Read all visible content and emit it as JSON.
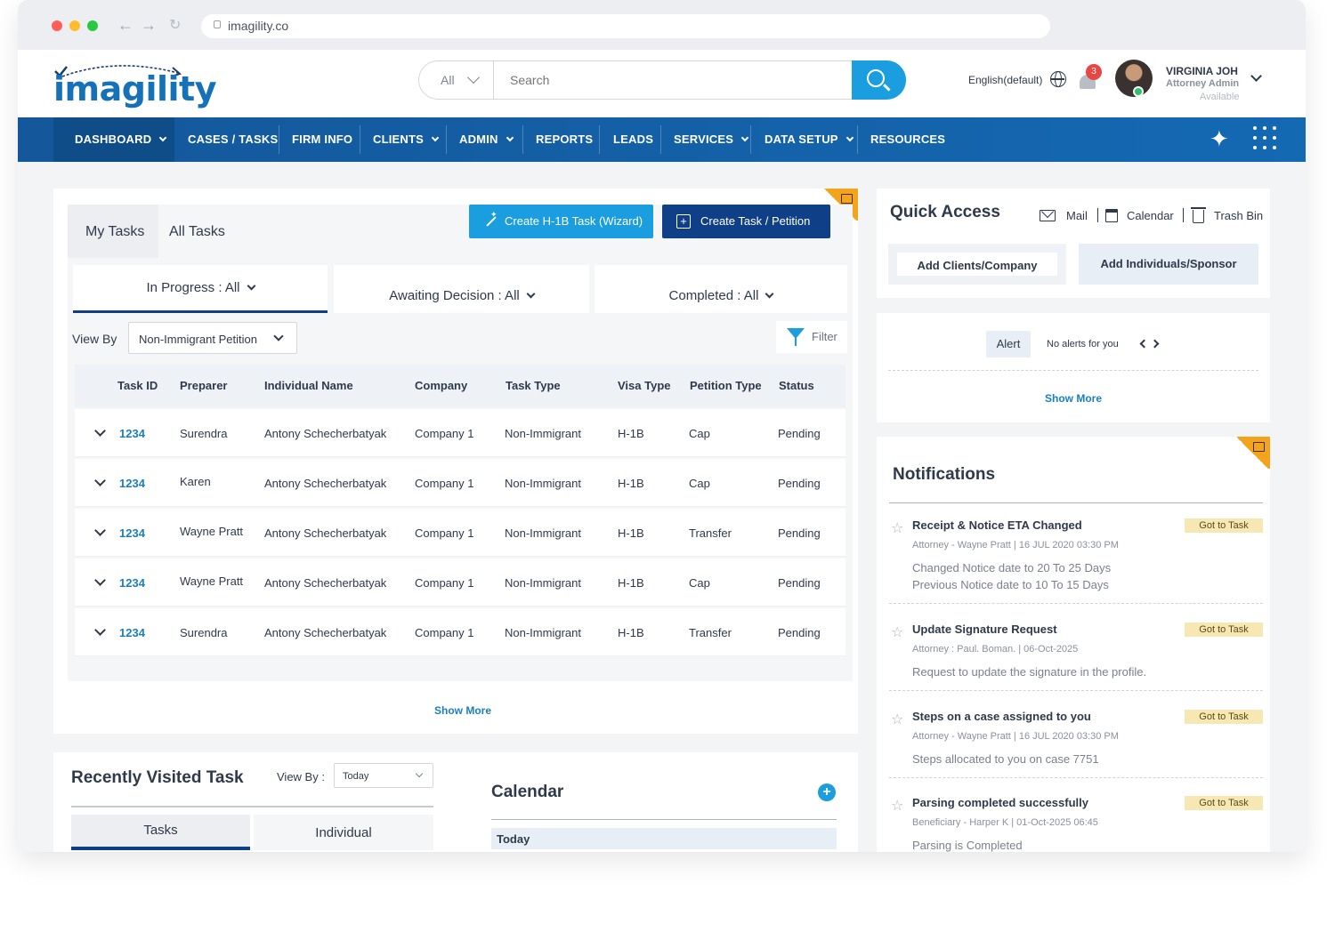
{
  "browser": {
    "url": "imagility.co"
  },
  "brand": {
    "logo_text": "imagility",
    "primary": "#1469b3",
    "accent": "#1a9ee0",
    "dark": "#0f3f86"
  },
  "header": {
    "search_scope": "All",
    "search_placeholder": "Search",
    "language": "English(default)",
    "notification_count": "3",
    "user_name": "VIRGINIA JOH",
    "user_role": "Attorney Admin",
    "user_status": "Available"
  },
  "nav": {
    "items": [
      {
        "label": "DASHBOARD",
        "dropdown": true
      },
      {
        "label": "CASES / TASKS",
        "dropdown": false
      },
      {
        "label": "FIRM INFO",
        "dropdown": false
      },
      {
        "label": "CLIENTS",
        "dropdown": true
      },
      {
        "label": "ADMIN",
        "dropdown": true
      },
      {
        "label": "REPORTS",
        "dropdown": false
      },
      {
        "label": "LEADS",
        "dropdown": false
      },
      {
        "label": "SERVICES",
        "dropdown": true
      },
      {
        "label": "DATA SETUP",
        "dropdown": true
      },
      {
        "label": "RESOURCES",
        "dropdown": false
      }
    ],
    "active_index": 0
  },
  "tasks": {
    "tab_my": "My Tasks",
    "tab_all": "All Tasks",
    "btn_wizard": "Create H-1B Task (Wizard)",
    "btn_create": "Create Task / Petition",
    "status_tabs": [
      "In Progress : All",
      "Awaiting Decision : All",
      "Completed : All"
    ],
    "view_by_label": "View By",
    "view_by_value": "Non-Immigrant Petition",
    "filter_label": "Filter",
    "columns": [
      "Task ID",
      "Preparer",
      "Individual Name",
      "Company",
      "Task Type",
      "Visa Type",
      "Petition Type",
      "Status"
    ],
    "rows": [
      [
        "1234",
        "Surendra",
        "Antony Schecherbatyak",
        "Company 1",
        "Non-Immigrant",
        "H-1B",
        "Cap",
        "Pending"
      ],
      [
        "1234",
        "Karen",
        "Antony Schecherbatyak",
        "Company 1",
        "Non-Immigrant",
        "H-1B",
        "Cap",
        "Pending"
      ],
      [
        "1234",
        "Wayne Pratt",
        "Antony Schecherbatyak",
        "Company 1",
        "Non-Immigrant",
        "H-1B",
        "Transfer",
        "Pending"
      ],
      [
        "1234",
        "Wayne Pratt",
        "Antony Schecherbatyak",
        "Company 1",
        "Non-Immigrant",
        "H-1B",
        "Cap",
        "Pending"
      ],
      [
        "1234",
        "Surendra",
        "Antony Schecherbatyak",
        "Company 1",
        "Non-Immigrant",
        "H-1B",
        "Transfer",
        "Pending"
      ]
    ],
    "show_more": "Show More"
  },
  "quick_access": {
    "title": "Quick Access",
    "mail": "Mail",
    "calendar": "Calendar",
    "trash": "Trash Bin",
    "btn_clients": "Add Clients/Company",
    "btn_individuals": "Add Individuals/Sponsor"
  },
  "alerts": {
    "chip": "Alert",
    "text": "No alerts for you",
    "show_more": "Show More"
  },
  "notifications": {
    "title": "Notifications",
    "go_label": "Got to Task",
    "items": [
      {
        "title": "Receipt & Notice ETA Changed",
        "meta": "Attorney - Wayne Pratt | 16 JUL 2020 03:30 PM",
        "line1": "Changed Notice date to 20 To 25 Days",
        "line2": "Previous Notice date to 10 To 15 Days"
      },
      {
        "title": "Update Signature Request",
        "meta": "Attorney : Paul. Boman. | 06-Oct-2025",
        "line1": "Request to update the signature in the profile.",
        "line2": ""
      },
      {
        "title": "Steps on a case assigned to you",
        "meta": "Attorney - Wayne Pratt | 16 JUL 2020 03:30 PM",
        "line1": "Steps allocated to you on case 7751",
        "line2": ""
      },
      {
        "title": "Parsing completed successfully",
        "meta": "Beneficiary - Harper K | 01-Oct-2025 06:45",
        "line1": "Parsing is Completed",
        "line2": ""
      }
    ]
  },
  "recent": {
    "title": "Recently Visited Task",
    "view_by": "View By :",
    "view_by_value": "Today",
    "tab_tasks": "Tasks",
    "tab_individual": "Individual"
  },
  "calendar": {
    "title": "Calendar",
    "today": "Today"
  }
}
